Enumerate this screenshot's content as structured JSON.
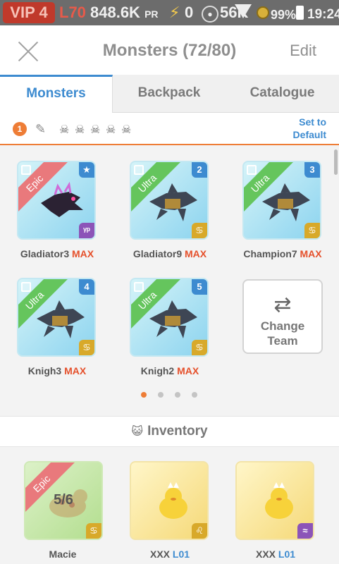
{
  "statusbar": {
    "vip": "VIP 4",
    "level": "L70",
    "power": "848.6K",
    "power_unit": "PR",
    "energy": "0",
    "food": "56K",
    "battery": "99%",
    "time": "19:24"
  },
  "header": {
    "title": "Monsters (72/80)",
    "edit": "Edit"
  },
  "tabs": [
    "Monsters",
    "Backpack",
    "Catalogue"
  ],
  "team": {
    "number": "1",
    "default_label": "Set to\nDefault"
  },
  "monsters": [
    {
      "name": "Gladiator3",
      "suffix": "MAX",
      "rarity": "Epic",
      "slot": "★",
      "element": "ᵞᵖ"
    },
    {
      "name": "Gladiator9",
      "suffix": "MAX",
      "rarity": "Ultra",
      "slot": "2",
      "element": "♋"
    },
    {
      "name": "Champion7",
      "suffix": "MAX",
      "rarity": "Ultra",
      "slot": "3",
      "element": "♋"
    },
    {
      "name": "Knigh3",
      "suffix": "MAX",
      "rarity": "Ultra",
      "slot": "4",
      "element": "♋"
    },
    {
      "name": "Knigh2",
      "suffix": "MAX",
      "rarity": "Ultra",
      "slot": "5",
      "element": "♋"
    }
  ],
  "change_team": "Change\nTeam",
  "inventory": {
    "title": "Inventory",
    "items": [
      {
        "name": "Macie",
        "level": "",
        "rarity": "Epic",
        "count": "5/6",
        "element": "♋"
      },
      {
        "name": "XXX",
        "level": "L01",
        "rarity": "",
        "count": "",
        "element": "♌"
      },
      {
        "name": "XXX",
        "level": "L01",
        "rarity": "",
        "count": "",
        "element": "≈"
      }
    ]
  },
  "colors": {
    "accent": "#3d8bd0",
    "orange": "#ee7d36",
    "max_red": "#e5502b",
    "epic": "#e9797c",
    "ultra": "#65c55d"
  },
  "pagination": {
    "total": 4,
    "active": 1
  }
}
